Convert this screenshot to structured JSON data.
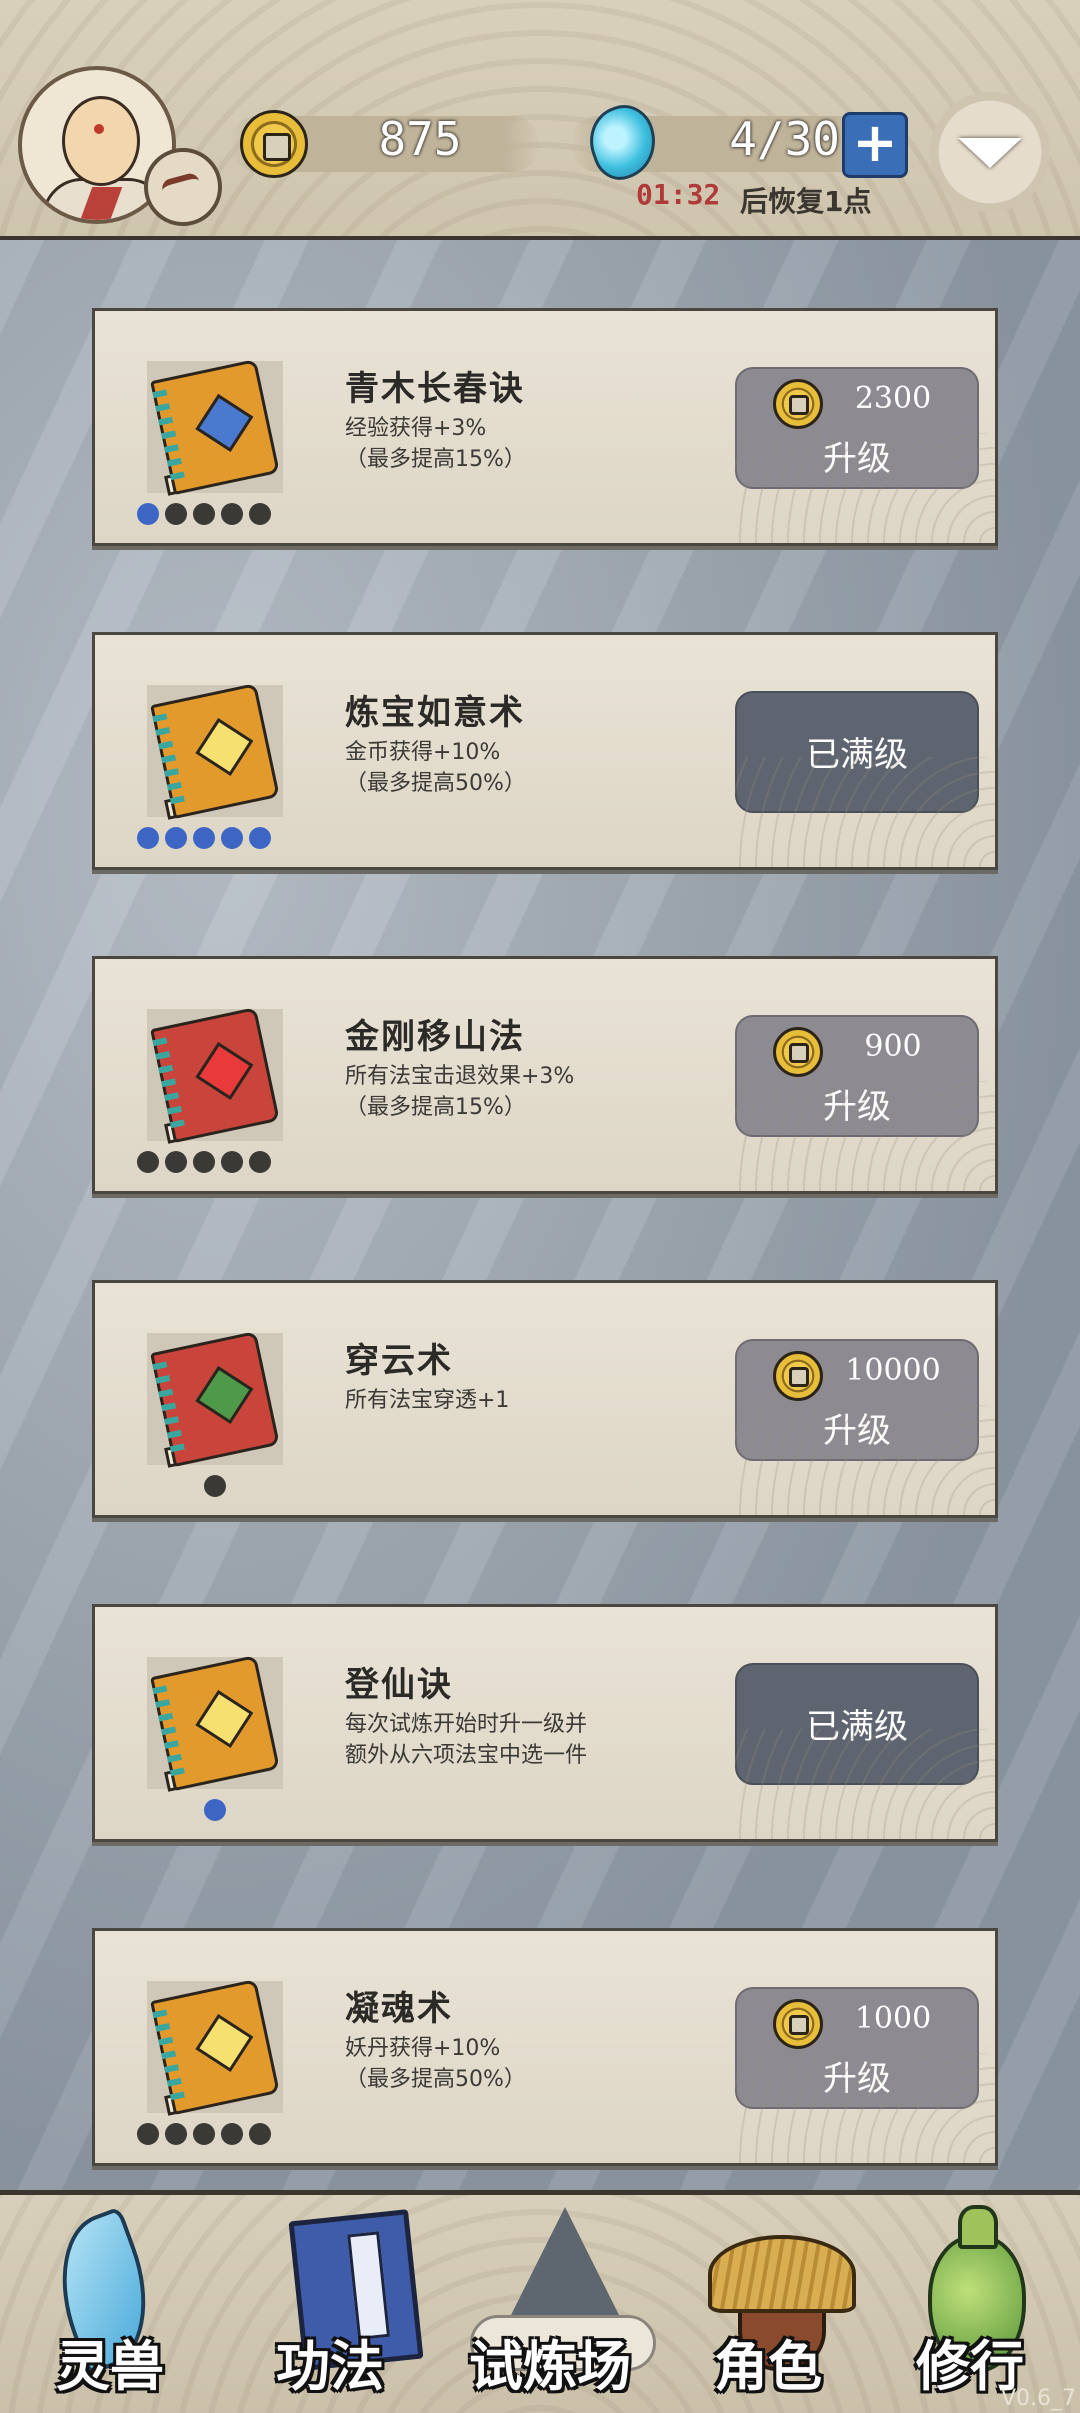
{
  "header": {
    "coins": "875",
    "energy": "4/30",
    "add_energy_label": "+",
    "timer": "01:32",
    "timer_suffix": "后恢复1点"
  },
  "skills": [
    {
      "title": "青木长春诀",
      "desc": "经验获得+3%\n（最多提高15%）",
      "level_filled": 1,
      "level_max": 5,
      "cost": "2300",
      "button": "升级",
      "maxed": false,
      "book_color": "orange",
      "gem": "blue-gem-icon"
    },
    {
      "title": "炼宝如意术",
      "desc": "金币获得+10%\n（最多提高50%）",
      "level_filled": 5,
      "level_max": 5,
      "cost": "",
      "button": "已满级",
      "maxed": true,
      "book_color": "orange",
      "gem": "yellow-gem-icon"
    },
    {
      "title": "金刚移山法",
      "desc": "所有法宝击退效果+3%\n（最多提高15%）",
      "level_filled": 0,
      "level_max": 5,
      "cost": "900",
      "button": "升级",
      "maxed": false,
      "book_color": "red",
      "gem": "red-gem-icon"
    },
    {
      "title": "穿云术",
      "desc": "所有法宝穿透+1",
      "level_filled": 0,
      "level_max": 1,
      "cost": "10000",
      "button": "升级",
      "maxed": false,
      "book_color": "red",
      "gem": "green-gem-icon"
    },
    {
      "title": "登仙诀",
      "desc": "每次试炼开始时升一级并\n额外从六项法宝中选一件",
      "level_filled": 1,
      "level_max": 1,
      "cost": "",
      "button": "已满级",
      "maxed": true,
      "book_color": "orange",
      "gem": "yellow-gem-icon"
    },
    {
      "title": "凝魂术",
      "desc": "妖丹获得+10%\n（最多提高50%）",
      "level_filled": 0,
      "level_max": 5,
      "cost": "1000",
      "button": "升级",
      "maxed": false,
      "book_color": "orange",
      "gem": "yellow-gem-icon"
    }
  ],
  "nav": {
    "items": [
      {
        "label": "灵兽",
        "icon": "feather-icon"
      },
      {
        "label": "功法",
        "icon": "technique-book-icon"
      },
      {
        "label": "试炼场",
        "icon": "mountain-icon"
      },
      {
        "label": "角色",
        "icon": "straw-hat-character-icon"
      },
      {
        "label": "修行",
        "icon": "gourd-icon"
      }
    ]
  },
  "version": "V0.6_7",
  "colors": {
    "dot_on": "#3d66c4",
    "dot_off": "#3a3936",
    "button": "#8d8a91",
    "button_maxed": "#5f6570"
  }
}
